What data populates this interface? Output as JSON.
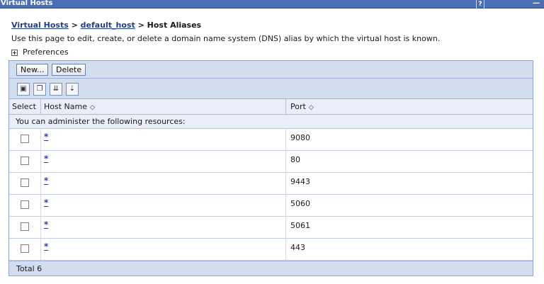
{
  "window": {
    "title": "Virtual Hosts",
    "help_label": "?",
    "minimize_label": "—"
  },
  "breadcrumb": {
    "link1": "Virtual Hosts",
    "sep": ">",
    "link2": "default_host",
    "current": "Host Aliases"
  },
  "description": "Use this page to edit, create, or delete a domain name system (DNS) alias by which the virtual host is known.",
  "preferences": {
    "toggle": "+",
    "label": "Preferences"
  },
  "buttons": {
    "new": "New...",
    "delete": "Delete"
  },
  "icons": {
    "select_all": "select-all-icon",
    "deselect_all": "deselect-all-icon",
    "show_filter": "show-filter-icon",
    "clear_filter": "clear-filter-icon"
  },
  "table": {
    "columns": {
      "select": "Select",
      "host": "Host Name",
      "port": "Port"
    },
    "sort_glyph": "◇",
    "resources_message": "You can administer the following resources:",
    "rows": [
      {
        "host": "*",
        "port": "9080"
      },
      {
        "host": "*",
        "port": "80"
      },
      {
        "host": "*",
        "port": "9443"
      },
      {
        "host": "*",
        "port": "5060"
      },
      {
        "host": "*",
        "port": "5061"
      },
      {
        "host": "*",
        "port": "443"
      }
    ],
    "total": "Total 6"
  },
  "colors": {
    "titlebar": "#4b6fb5",
    "toolbar": "#d2ddef",
    "link": "#1f3f8a"
  }
}
